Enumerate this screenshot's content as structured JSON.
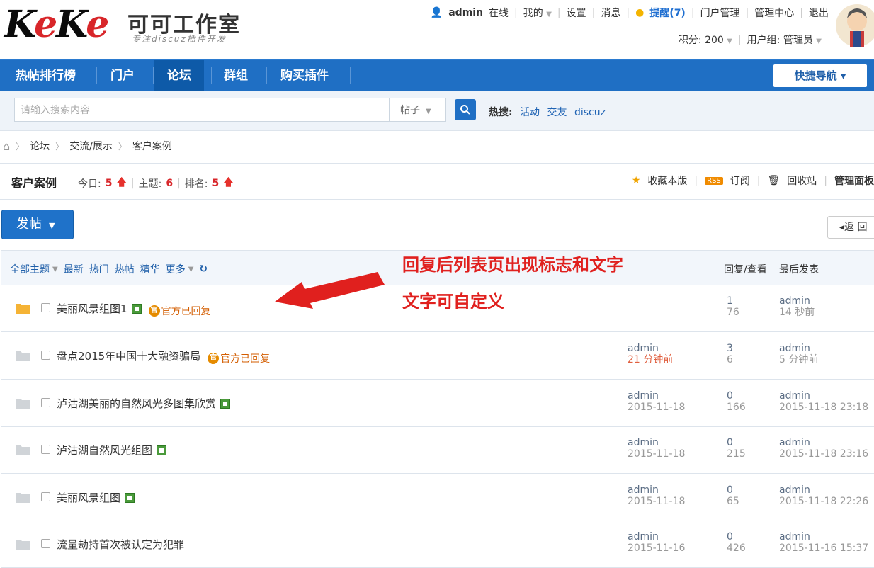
{
  "header": {
    "logo_text": "KeKe",
    "site_title": "可可工作室",
    "site_subtitle": "专注discuz插件开发",
    "user": "admin",
    "online": "在线",
    "my": "我的",
    "settings": "设置",
    "messages": "消息",
    "remind": "提醒(7)",
    "portal_manage": "门户管理",
    "admin_center": "管理中心",
    "logout": "退出",
    "points": "积分: 200",
    "usergroup": "用户组: 管理员"
  },
  "nav": {
    "items": [
      {
        "label": "热帖排行榜"
      },
      {
        "label": "门户"
      },
      {
        "label": "论坛"
      },
      {
        "label": "群组"
      },
      {
        "label": "购买插件"
      }
    ],
    "quick": "快捷导航 ▾"
  },
  "search": {
    "placeholder": "请输入搜索内容",
    "type": "帖子",
    "hot_label": "热搜:",
    "hot_links": [
      "活动",
      "交友",
      "discuz"
    ]
  },
  "breadcrumb": [
    "论坛",
    "交流/展示",
    "客户案例"
  ],
  "forum": {
    "title": "客户案例",
    "today_label": "今日:",
    "today_value": "5",
    "topics_label": "主题:",
    "topics_value": "6",
    "rank_label": "排名:",
    "rank_value": "5",
    "fav": "收藏本版",
    "subscribe": "订阅",
    "recycle": "回收站",
    "admin_panel": "管理面板"
  },
  "actions": {
    "post": "发帖",
    "back": "◂返 回"
  },
  "list": {
    "tabs": [
      "全部主题",
      "最新",
      "热门",
      "热帖",
      "精华",
      "更多"
    ],
    "col_replies": "回复/查看",
    "col_last": "最后发表",
    "rows": [
      {
        "title": "美丽风景组图1",
        "img": true,
        "badge": "官方已回复",
        "author": "",
        "time": "",
        "replies": "1",
        "views": "76",
        "last_user": "admin",
        "last_time": "14 秒前"
      },
      {
        "title": "盘点2015年中国十大融资骗局",
        "img": false,
        "badge": "官方已回复",
        "author": "admin",
        "time": "21 分钟前",
        "replies": "3",
        "views": "6",
        "last_user": "admin",
        "last_time": "5 分钟前"
      },
      {
        "title": "泸沽湖美丽的自然风光多图集欣赏",
        "img": true,
        "badge": "",
        "author": "admin",
        "time": "2015-11-18",
        "replies": "0",
        "views": "166",
        "last_user": "admin",
        "last_time": "2015-11-18 23:18"
      },
      {
        "title": "泸沽湖自然风光组图",
        "img": true,
        "badge": "",
        "author": "admin",
        "time": "2015-11-18",
        "replies": "0",
        "views": "215",
        "last_user": "admin",
        "last_time": "2015-11-18 23:16"
      },
      {
        "title": "美丽风景组图",
        "img": true,
        "badge": "",
        "author": "admin",
        "time": "2015-11-18",
        "replies": "0",
        "views": "65",
        "last_user": "admin",
        "last_time": "2015-11-18 22:26"
      },
      {
        "title": "流量劫持首次被认定为犯罪",
        "img": false,
        "badge": "",
        "author": "admin",
        "time": "2015-11-16",
        "replies": "0",
        "views": "426",
        "last_user": "admin",
        "last_time": "2015-11-16 15:37"
      }
    ]
  },
  "annotation": {
    "line1": "回复后列表页出现标志和文字",
    "line2": "文字可自定义"
  }
}
